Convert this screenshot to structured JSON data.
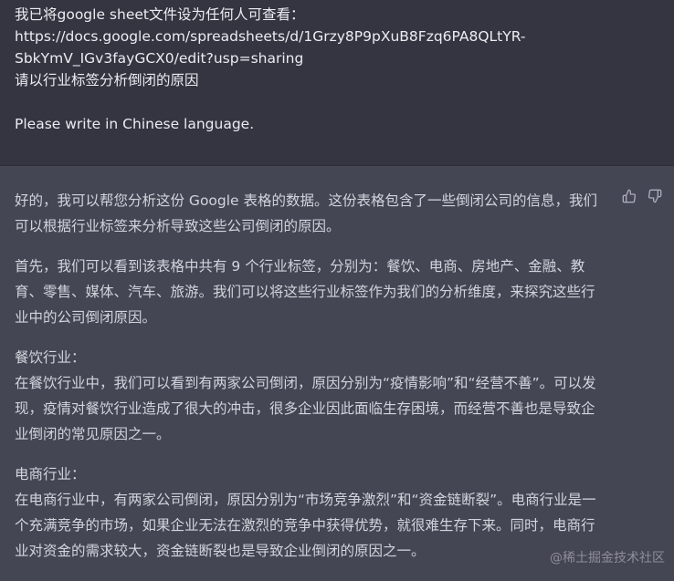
{
  "user_message": {
    "lines": [
      "我已将google sheet文件设为任何人可查看：",
      "https://docs.google.com/spreadsheets/d/1Grzy8P9pXuB8Fzq6PA8QLtYR-",
      "SbkYmV_IGv3fayGCX0/edit?usp=sharing",
      "请以行业标签分析倒闭的原因",
      "Please write in Chinese language."
    ]
  },
  "assistant_message": {
    "paragraphs": [
      "好的，我可以帮您分析这份 Google 表格的数据。这份表格包含了一些倒闭公司的信息，我们可以根据行业标签来分析导致这些公司倒闭的原因。",
      "首先，我们可以看到该表格中共有 9 个行业标签，分别为：餐饮、电商、房地产、金融、教育、零售、媒体、汽车、旅游。我们可以将这些行业标签作为我们的分析维度，来探究这些行业中的公司倒闭原因。"
    ],
    "sections": [
      {
        "title": "餐饮行业：",
        "body": "在餐饮行业中，我们可以看到有两家公司倒闭，原因分别为“疫情影响”和“经营不善”。可以发现，疫情对餐饮行业造成了很大的冲击，很多企业因此面临生存困境，而经营不善也是导致企业倒闭的常见原因之一。"
      },
      {
        "title": "电商行业：",
        "body": "在电商行业中，有两家公司倒闭，原因分别为“市场竞争激烈”和“资金链断裂”。电商行业是一个充满竞争的市场，如果企业无法在激烈的竞争中获得优势，就很难生存下来。同时，电商行业对资金的需求较大，资金链断裂也是导致企业倒闭的原因之一。"
      }
    ]
  },
  "feedback": {
    "thumbs_up_icon": "thumbs-up-icon",
    "thumbs_down_icon": "thumbs-down-icon"
  },
  "watermark": "@稀土掘金技术社区",
  "colors": {
    "user_bg": "#343541",
    "assistant_bg": "#444654",
    "user_text": "#ececf1",
    "assistant_text": "#d1d5db"
  }
}
